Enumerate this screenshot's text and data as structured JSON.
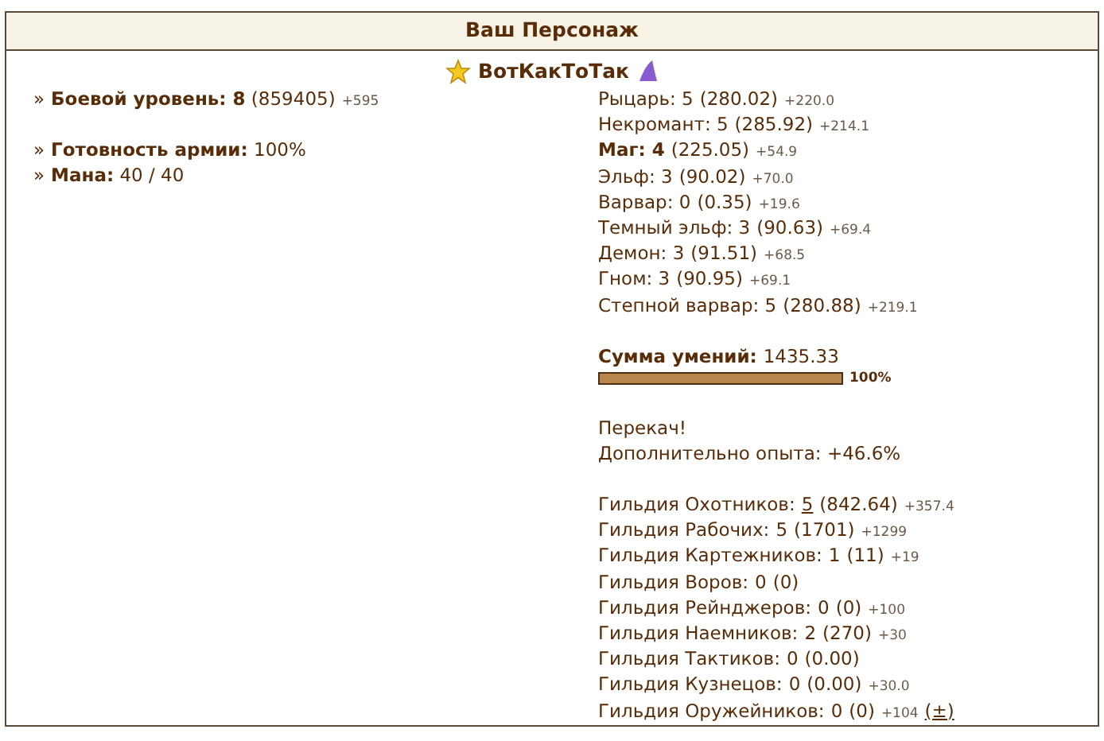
{
  "title": "Ваш Персонаж",
  "character": {
    "name": "ВотКакТоТак"
  },
  "stat_groups": [
    [
      {
        "bullet": "»",
        "text": "**Боевой уровень: 8** (859405)",
        "gain": "+595"
      }
    ],
    [
      {
        "bullet": "»",
        "text": "**Готовность армии:** 100%"
      },
      {
        "bullet": "»",
        "text": "**Мана:** 40 / 40"
      }
    ]
  ],
  "factions": [
    {
      "name": "Рыцарь:",
      "level": "5",
      "points": "(280.02)",
      "gain": "+220.0",
      "current": false
    },
    {
      "name": "Некромант:",
      "level": "5",
      "points": "(285.92)",
      "gain": "+214.1",
      "current": false
    },
    {
      "name": "Маг:",
      "level": "4",
      "points": "(225.05)",
      "gain": "+54.9",
      "current": true
    },
    {
      "name": "Эльф:",
      "level": "3",
      "points": "(90.02)",
      "gain": "+70.0",
      "current": false
    },
    {
      "name": "Варвар:",
      "level": "0",
      "points": "(0.35)",
      "gain": "+19.6",
      "current": false
    },
    {
      "name": "Темный эльф:",
      "level": "3",
      "points": "(90.63)",
      "gain": "+69.4",
      "current": false
    },
    {
      "name": "Демон:",
      "level": "3",
      "points": "(91.51)",
      "gain": "+68.5",
      "current": false
    },
    {
      "name": "Гном:",
      "level": "3",
      "points": "(90.95)",
      "gain": "+69.1",
      "current": false
    },
    {
      "name": "Степной варвар:",
      "level": "5",
      "points": "(280.88)",
      "gain": "+219.1",
      "current": false
    }
  ],
  "skills_total": {
    "label": "Сумма умений:",
    "value": "1435.33",
    "level": 1.0,
    "percent": "100%"
  },
  "notes": [
    "Перекач!",
    "Дополнительно опыта: +46.6%"
  ],
  "guilds": [
    {
      "name": "Гильдия Охотников:",
      "level": "5",
      "points": "(842.64)",
      "gain": "+357.4",
      "level_link": true
    },
    {
      "name": "Гильдия Рабочих:",
      "level": "5",
      "points": "(1701)",
      "gain": "+1299",
      "level_link": false
    },
    {
      "name": "Гильдия Картежников:",
      "level": "1",
      "points": "(11)",
      "gain": "+19",
      "level_link": false
    },
    {
      "name": "Гильдия Воров:",
      "level": "0",
      "points": "(0)",
      "level_link": false
    },
    {
      "name": "Гильдия Рейнджеров:",
      "level": "0",
      "points": "(0)",
      "gain": "+100",
      "level_link": false
    },
    {
      "name": "Гильдия Наемников:",
      "level": "2",
      "points": "(270)",
      "gain": "+30",
      "level_link": false
    },
    {
      "name": "Гильдия Тактиков:",
      "level": "0",
      "points": "(0.00)",
      "level_link": false
    },
    {
      "name": "Гильдия Кузнецов:",
      "level": "0",
      "points": "(0.00)",
      "gain": "+30.0",
      "level_link": false
    },
    {
      "name": "Гильдия Оружейников:",
      "level": "0",
      "points": "(0)",
      "gain": "+104",
      "level_link": false,
      "action": "(±)"
    }
  ]
}
